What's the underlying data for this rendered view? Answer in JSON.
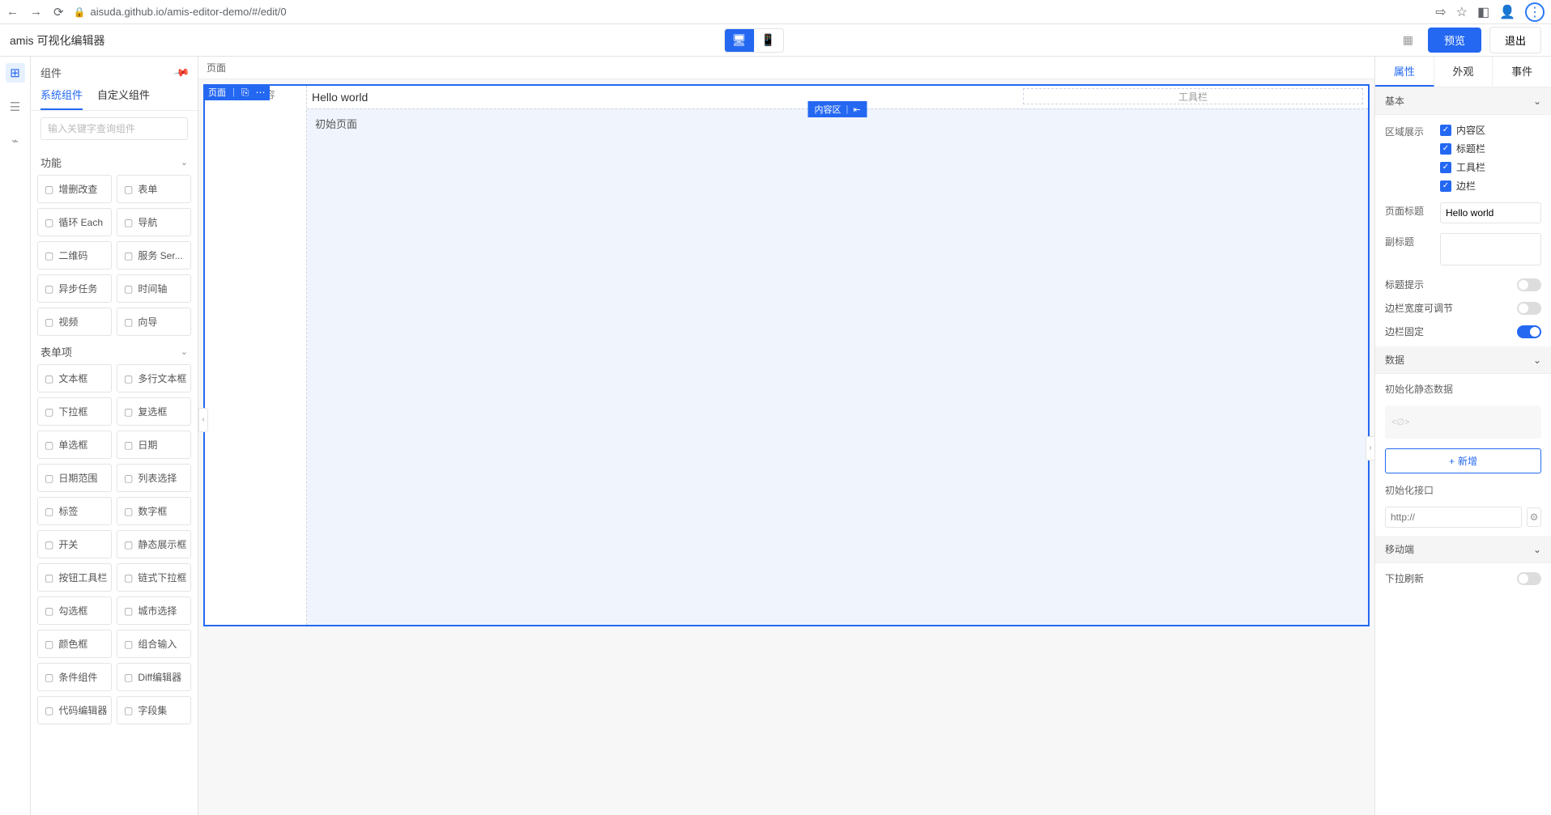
{
  "browser": {
    "url": "aisuda.github.io/amis-editor-demo/#/edit/0"
  },
  "app": {
    "title": "amis 可视化编辑器",
    "preview": "预览",
    "exit": "退出"
  },
  "leftPanel": {
    "title": "组件",
    "tabs": {
      "system": "系统组件",
      "custom": "自定义组件"
    },
    "searchPlaceholder": "输入关键字查询组件",
    "cat1": "功能",
    "cat2": "表单项",
    "func": [
      "增删改查",
      "表单",
      "循环 Each",
      "导航",
      "二维码",
      "服务 Ser...",
      "异步任务",
      "时间轴",
      "视频",
      "向导"
    ],
    "form": [
      "文本框",
      "多行文本框",
      "下拉框",
      "复选框",
      "单选框",
      "日期",
      "日期范围",
      "列表选择",
      "标签",
      "数字框",
      "开关",
      "静态展示框",
      "按钮工具栏",
      "链式下拉框",
      "勾选框",
      "城市选择",
      "颜色框",
      "组合输入",
      "条件组件",
      "Diff编辑器",
      "代码编辑器",
      "字段集"
    ]
  },
  "canvas": {
    "crumb": "页面",
    "selLabel": "页面",
    "sidebarLabel": "边栏内容",
    "pageTitle": "Hello world",
    "toolbarLabel": "工具栏",
    "bodyTag": "内容区",
    "bodyText": "初始页面"
  },
  "rightPanel": {
    "tabs": {
      "attr": "属性",
      "look": "外观",
      "event": "事件"
    },
    "sec_basic": "基本",
    "sec_data": "数据",
    "sec_mobile": "移动端",
    "regionLabel": "区域展示",
    "regions": {
      "body": "内容区",
      "title": "标题栏",
      "toolbar": "工具栏",
      "aside": "边栏"
    },
    "pageTitleLabel": "页面标题",
    "pageTitleValue": "Hello world",
    "subtitleLabel": "副标题",
    "titleTip": "标题提示",
    "asideResize": "边栏宽度可调节",
    "asideFixed": "边栏固定",
    "initStatic": "初始化静态数据",
    "addNew": "新增",
    "initApi": "初始化接口",
    "apiPlaceholder": "http://",
    "pullRefresh": "下拉刷新"
  }
}
